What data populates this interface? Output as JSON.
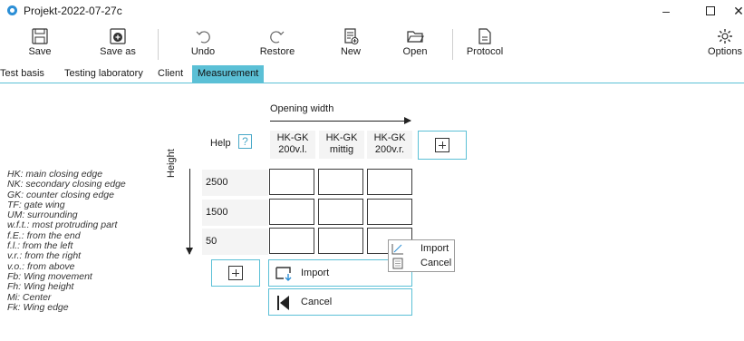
{
  "window": {
    "title": "Projekt-2022-07-27c",
    "min_glyph": "–",
    "close_glyph": "✕"
  },
  "toolbar": {
    "save": "Save",
    "save_as": "Save as",
    "undo": "Undo",
    "restore": "Restore",
    "new": "New",
    "open": "Open",
    "protocol": "Protocol",
    "options": "Options"
  },
  "tabs": [
    "Test basis",
    "Testing laboratory",
    "Client",
    "Measurement"
  ],
  "active_tab": "Measurement",
  "measurement": {
    "opening_width_label": "Opening width",
    "height_label": "Height",
    "help_label": "Help",
    "help_icon_glyph": "?",
    "columns": [
      {
        "line1": "HK-GK",
        "line2": "200v.l."
      },
      {
        "line1": "HK-GK",
        "line2": "mittig"
      },
      {
        "line1": "HK-GK",
        "line2": "200v.r."
      }
    ],
    "rows": [
      "2500",
      "1500",
      "50"
    ],
    "import_label": "Import",
    "cancel_label": "Cancel"
  },
  "legend": [
    "HK: main closing edge",
    "NK: secondary closing edge",
    "GK: counter closing edge",
    "TF: gate wing",
    "UM: surrounding",
    "w.f.t.: most protruding part",
    "f.E.: from the end",
    "f.l.: from the left",
    "v.r.: from the right",
    "v.o.: from above",
    "Fb: Wing movement",
    "Fh: Wing height",
    "Mi: Center",
    "Fk: Wing edge"
  ],
  "context_menu": {
    "import": "Import",
    "cancel": "Cancel"
  },
  "colors": {
    "accent": "#5bc0d6",
    "app_icon": "#2c8fd6"
  },
  "icons": {
    "app": "app-logo-icon",
    "save": "floppy-disk-icon",
    "save_as": "floppy-disk-plus-icon",
    "undo": "undo-arrow-icon",
    "restore": "redo-arrow-icon",
    "new": "new-document-icon",
    "open": "folder-open-icon",
    "protocol": "document-icon",
    "options": "gear-icon",
    "help": "question-mark-icon",
    "import": "import-icon",
    "cancel": "cancel-arrow-icon"
  }
}
